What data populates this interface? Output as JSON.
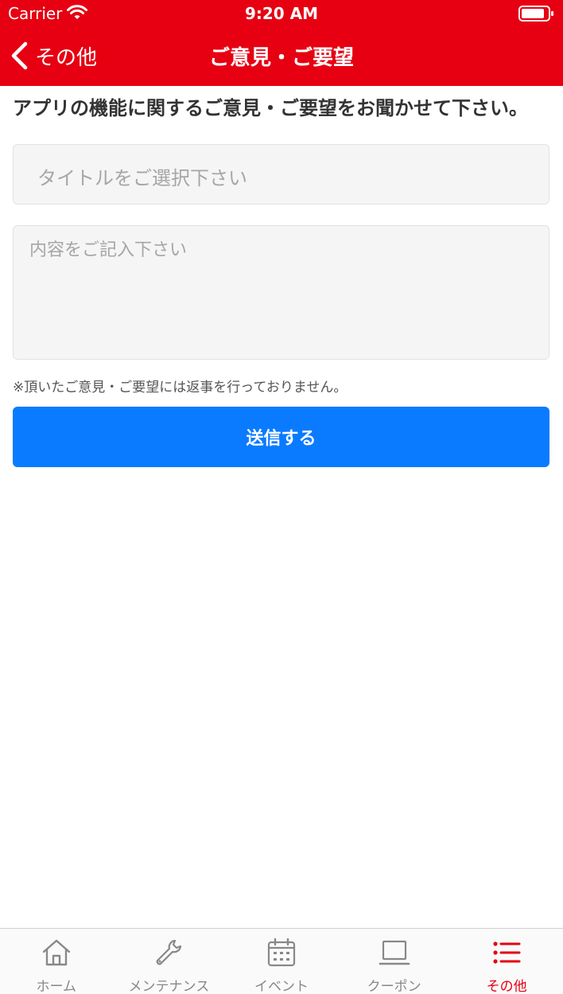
{
  "status_bar": {
    "carrier": "Carrier",
    "time": "9:20 AM"
  },
  "nav": {
    "back_label": "その他",
    "title": "ご意見・ご要望"
  },
  "form": {
    "intro": "アプリの機能に関するご意見・ご要望をお聞かせて下さい。",
    "title_placeholder": "タイトルをご選択下さい",
    "content_placeholder": "内容をご記入下さい",
    "note": "※頂いたご意見・ご要望には返事を行っておりません。",
    "submit_label": "送信する"
  },
  "tabs": [
    {
      "label": "ホーム",
      "icon": "home-icon"
    },
    {
      "label": "メンテナンス",
      "icon": "wrench-icon"
    },
    {
      "label": "イベント",
      "icon": "calendar-icon"
    },
    {
      "label": "クーポン",
      "icon": "laptop-icon"
    },
    {
      "label": "その他",
      "icon": "list-icon",
      "active": true
    }
  ],
  "colors": {
    "brand": "#e60012",
    "button": "#0a7bff",
    "tab_inactive": "#888888"
  }
}
